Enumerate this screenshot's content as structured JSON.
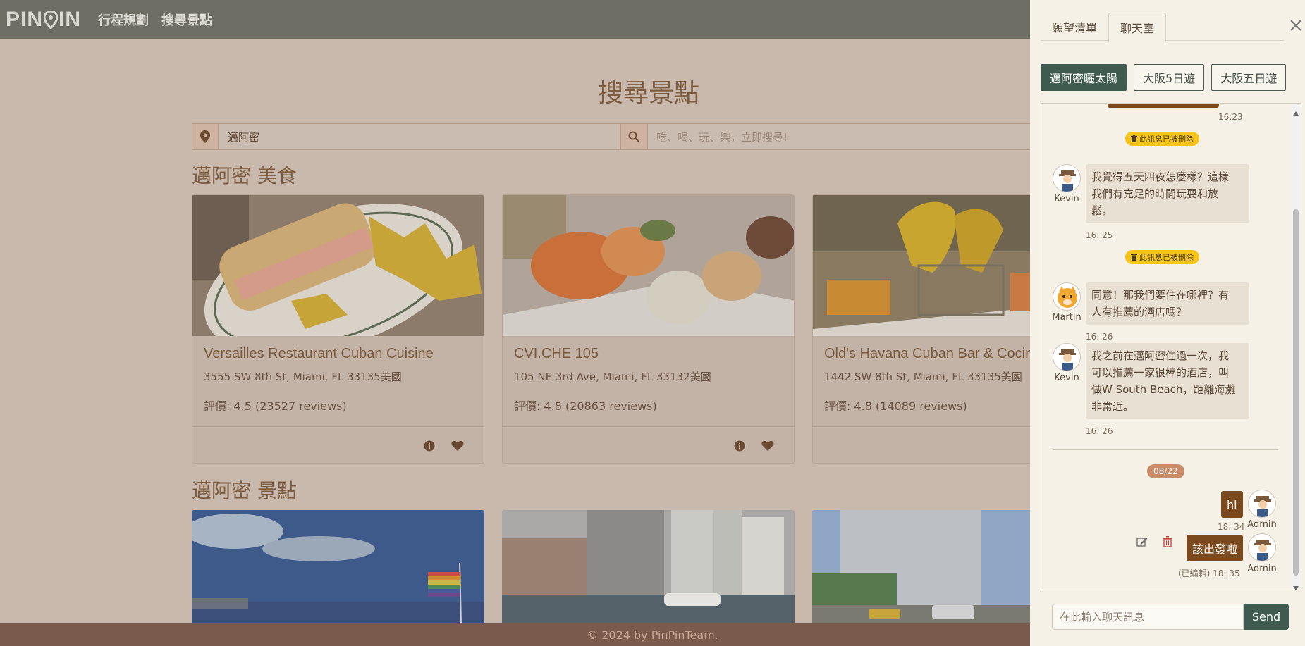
{
  "navbar": {
    "logo": "PINPIN",
    "links": [
      "行程規劃",
      "搜尋景點"
    ]
  },
  "main": {
    "title": "搜尋景點",
    "search": {
      "location_value": "邁阿密",
      "keyword_placeholder": "吃、喝、玩、樂，立即搜尋!"
    },
    "food_section_title": "邁阿密 美食",
    "attraction_section_title": "邁阿密 景點",
    "food_cards": [
      {
        "name": "Versailles Restaurant Cuban Cuisine",
        "address": "3555 SW 8th St, Miami, FL 33135美國",
        "rating": "評價: 4.5 (23527 reviews)"
      },
      {
        "name": "CVI.CHE 105",
        "address": "105 NE 3rd Ave, Miami, FL 33132美國",
        "rating": "評價: 4.8 (20863 reviews)"
      },
      {
        "name": "Old's Havana Cuban Bar & Cocina",
        "address": "1442 SW 8th St, Miami, FL 33135美國",
        "rating": "評價: 4.8 (14089 reviews)"
      }
    ]
  },
  "footer": {
    "text": "© 2024 by PinPinTeam."
  },
  "panel": {
    "tabs": [
      "願望清單",
      "聊天室"
    ],
    "active_tab": "聊天室",
    "rooms": [
      "邁阿密曬太陽",
      "大阪5日遊",
      "大阪五日遊"
    ],
    "active_room": "邁阿密曬太陽",
    "messages": {
      "top_time": "16:23",
      "deleted_label": "此訊息已被刪除",
      "m1": {
        "user": "Kevin",
        "text_lines": [
          "我覺得五天四夜怎麼樣？這樣",
          "我們有充足的時間玩耍和放",
          "鬆。"
        ],
        "time": "16: 25"
      },
      "m2": {
        "user": "Martin",
        "text_lines": [
          "同意！那我們要住在哪裡？有",
          "人有推薦的酒店嗎？"
        ],
        "time": "16: 26"
      },
      "m3": {
        "user": "Kevin",
        "text_lines": [
          "我之前在邁阿密住過一次，我",
          "可以推薦一家很棒的酒店，叫",
          "做W South Beach，距離海灘",
          "非常近。"
        ],
        "time": "16: 26"
      },
      "date": "08/22",
      "own1": {
        "user": "Admin",
        "text": "hi",
        "time": "18: 34"
      },
      "own2": {
        "user": "Admin",
        "text": "該出發啦",
        "time": "(已編輯) 18: 35"
      }
    },
    "input_placeholder": "在此輸入聊天訊息",
    "send_label": "Send"
  }
}
